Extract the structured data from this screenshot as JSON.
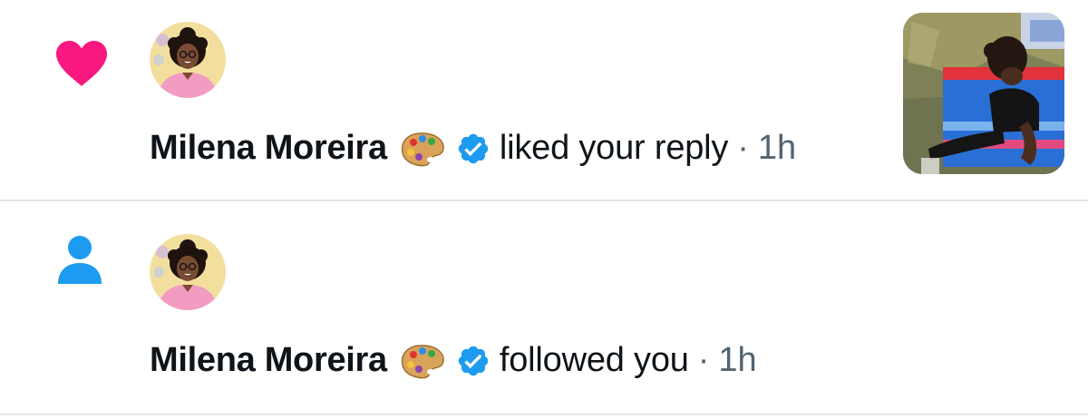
{
  "notifications": [
    {
      "type": "like",
      "icon": "heart-icon",
      "icon_color": "#f91880",
      "user_name": "Milena Moreira",
      "name_emoji": "🎨",
      "verified": true,
      "verified_color": "#1d9bf0",
      "action": "liked your reply",
      "separator": "·",
      "time": "1h"
    },
    {
      "type": "follow",
      "icon": "person-icon",
      "icon_color": "#1d9bf0",
      "user_name": "Milena Moreira",
      "name_emoji": "🎨",
      "verified": true,
      "verified_color": "#1d9bf0",
      "action": "followed you",
      "separator": "·",
      "time": "1h"
    }
  ],
  "colors": {
    "text_primary": "#0f1419",
    "text_secondary": "#536471",
    "divider": "#e1e4e8",
    "background": "#ffffff"
  }
}
